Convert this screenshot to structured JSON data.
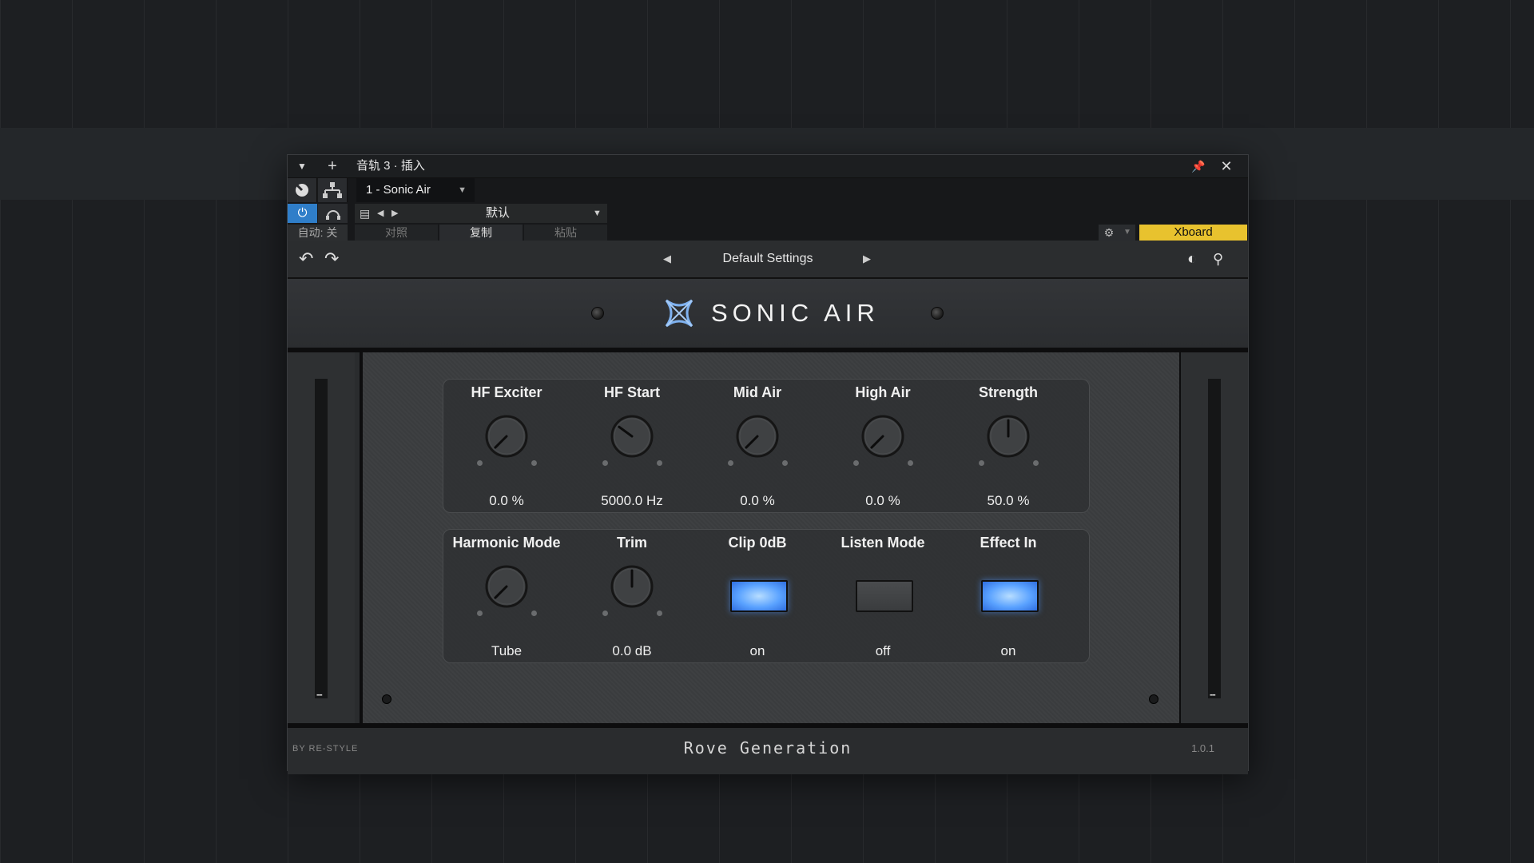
{
  "window": {
    "title": "音轨 3 · 插入",
    "track_selector": "1 - Sonic Air",
    "preset_name": "默认",
    "auto_label": "自动: 关",
    "compare_label": "对照",
    "copy_label": "复制",
    "paste_label": "粘贴",
    "xboard_label": "Xboard"
  },
  "plugin": {
    "preset": "Default Settings",
    "brand": "SONIC AIR",
    "by": "BY RE-STYLE",
    "maker": "Rove Generation",
    "version": "1.0.1"
  },
  "row1": [
    {
      "label": "HF Exciter",
      "value": "0.0 %",
      "level": 0.0
    },
    {
      "label": "HF Start",
      "value": "5000.0 Hz",
      "level": 0.3
    },
    {
      "label": "Mid Air",
      "value": "0.0 %",
      "level": 0.0
    },
    {
      "label": "High Air",
      "value": "0.0 %",
      "level": 0.0
    },
    {
      "label": "Strength",
      "value": "50.0 %",
      "level": 0.5
    }
  ],
  "row2": [
    {
      "label": "Harmonic Mode",
      "value": "Tube",
      "type": "knob",
      "level": 0.0
    },
    {
      "label": "Trim",
      "value": "0.0 dB",
      "type": "knob",
      "level": 0.5
    },
    {
      "label": "Clip 0dB",
      "value": "on",
      "type": "toggle",
      "state": true
    },
    {
      "label": "Listen Mode",
      "value": "off",
      "type": "toggle",
      "state": false
    },
    {
      "label": "Effect In",
      "value": "on",
      "type": "toggle",
      "state": true
    }
  ],
  "meters": {
    "left": "--",
    "right": "--"
  },
  "colors": {
    "power": "#2f7ec9",
    "xboard": "#e8c22e",
    "led_on": "#5aa2ff"
  }
}
